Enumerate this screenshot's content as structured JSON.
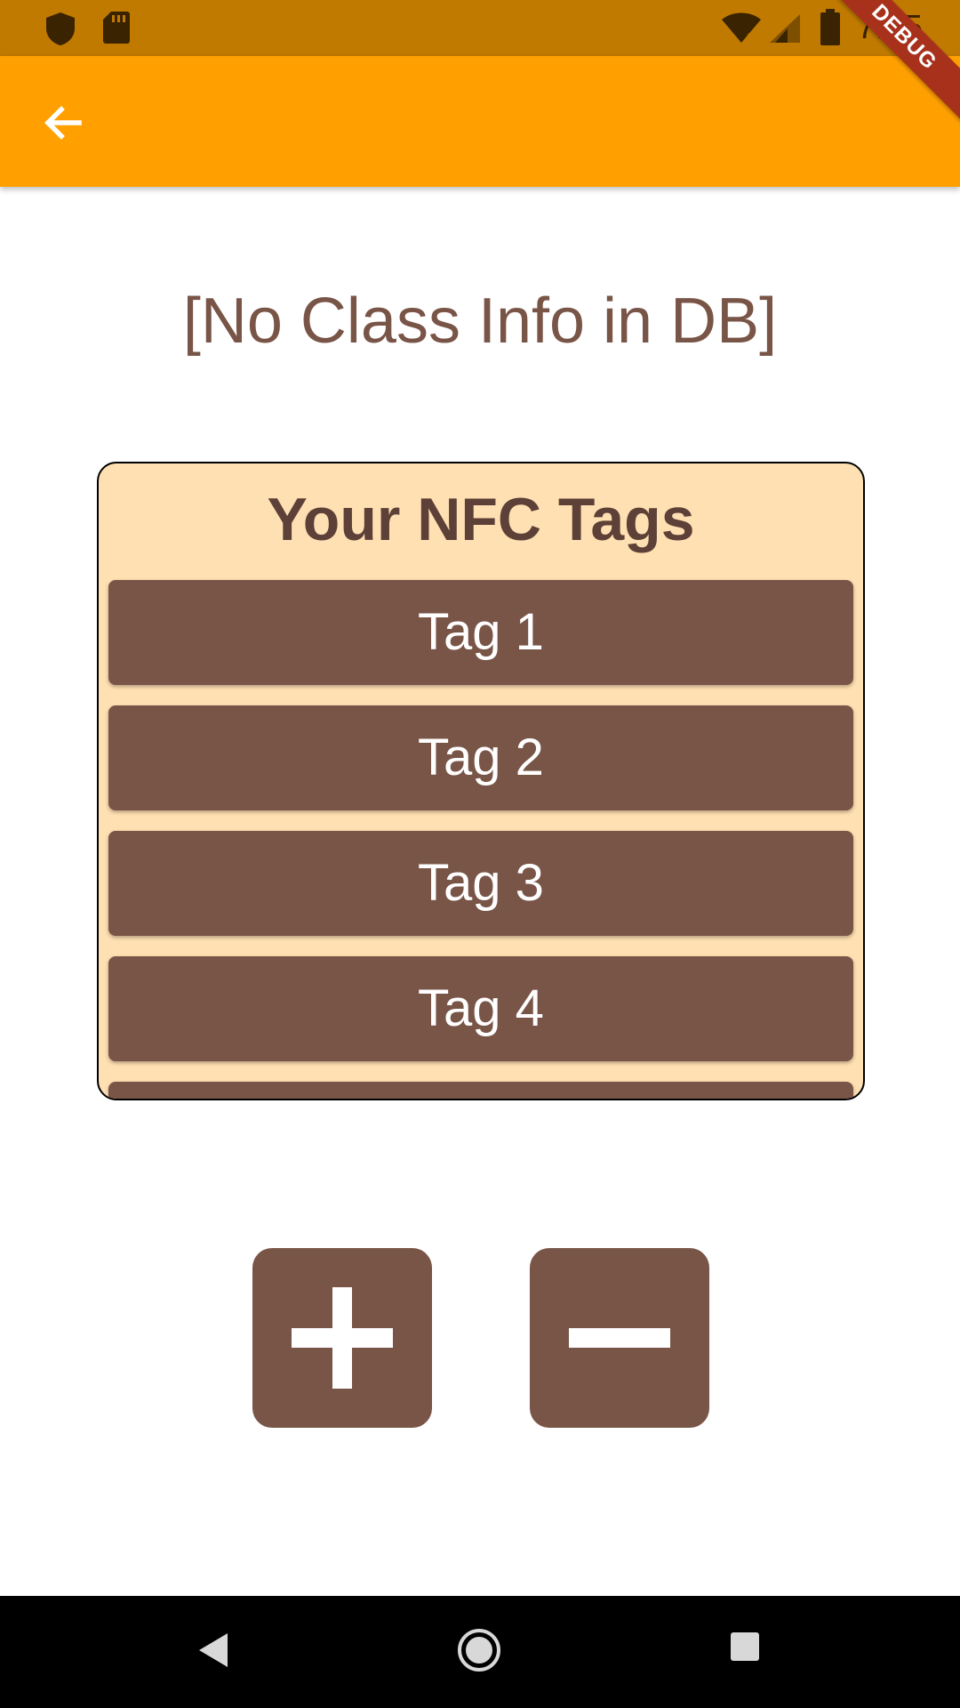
{
  "status_bar": {
    "time": "7:15",
    "left_icons": [
      "shield-icon",
      "sd-card-icon"
    ],
    "right_icons": [
      "wifi-icon",
      "signal-icon",
      "battery-icon"
    ]
  },
  "app_bar": {
    "back_icon": "arrow-back-icon",
    "color": "#ffa000",
    "debug_label": "DEBUG"
  },
  "class_info": "[No Class Info in DB]",
  "tags_panel": {
    "title": "Your NFC Tags",
    "tags": [
      {
        "label": "Tag 1"
      },
      {
        "label": "Tag 2"
      },
      {
        "label": "Tag 3"
      },
      {
        "label": "Tag 4"
      },
      {
        "label": ""
      }
    ]
  },
  "actions": {
    "add_icon": "plus-icon",
    "remove_icon": "minus-icon",
    "color": "#795548"
  },
  "nav_bar": {
    "items": [
      "back-triangle-icon",
      "home-circle-icon",
      "recents-square-icon"
    ]
  }
}
